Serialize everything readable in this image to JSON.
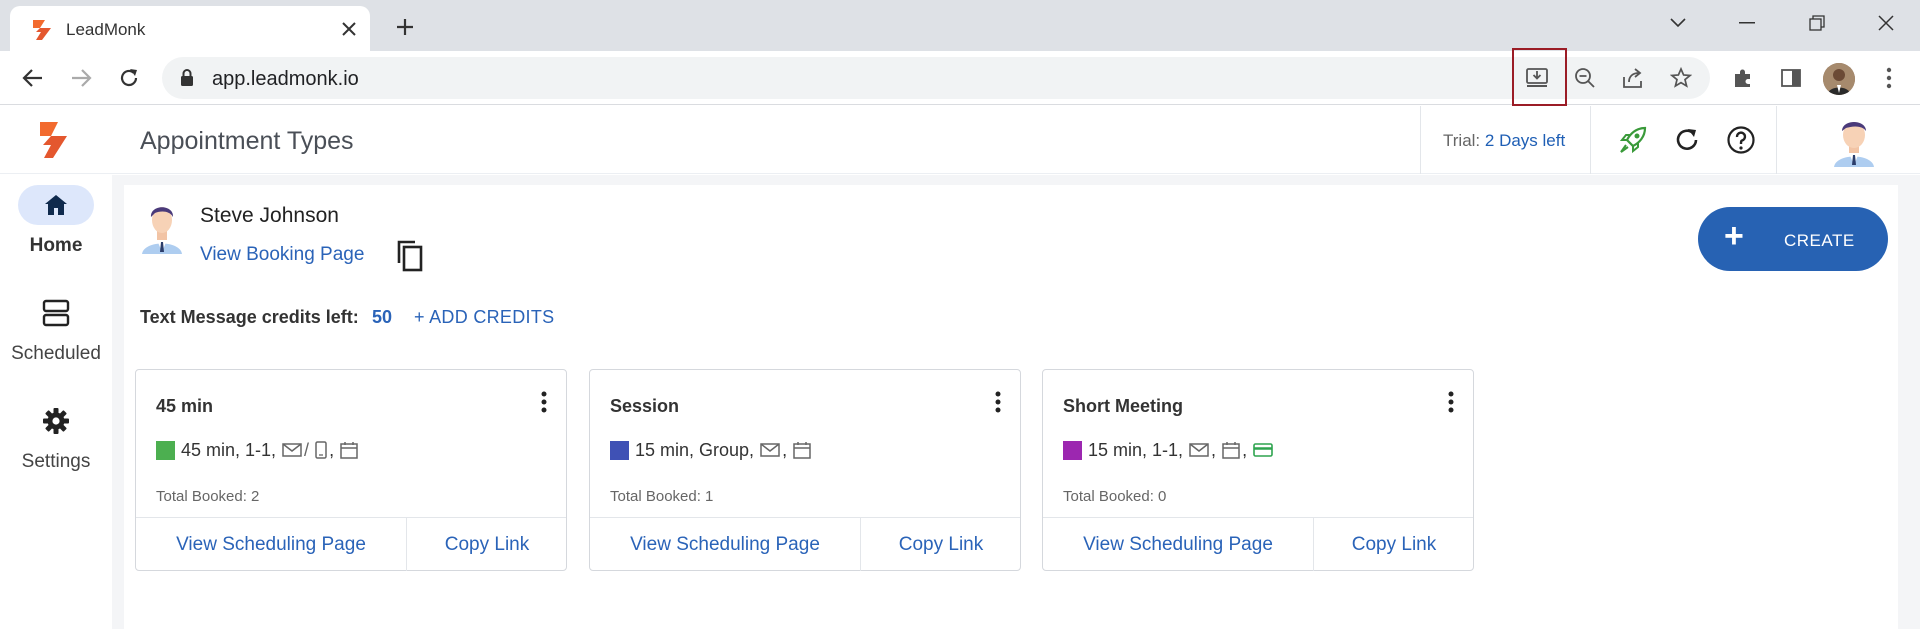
{
  "browser": {
    "tab_title": "LeadMonk",
    "url": "app.leadmonk.io"
  },
  "header": {
    "title": "Appointment Types",
    "trial_label": "Trial:",
    "trial_days": "2 Days left"
  },
  "sidebar": {
    "items": [
      {
        "label": "Home",
        "icon": "home-icon",
        "active": true
      },
      {
        "label": "Scheduled",
        "icon": "scheduled-icon",
        "active": false
      },
      {
        "label": "Settings",
        "icon": "gear-icon",
        "active": false
      }
    ]
  },
  "owner": {
    "name": "Steve Johnson",
    "booking_link": "View Booking Page"
  },
  "create_button": {
    "label": "CREATE"
  },
  "credits": {
    "label": "Text Message credits left:",
    "value": "50",
    "add_label": "+ ADD CREDITS"
  },
  "cards": [
    {
      "title": "45 min",
      "color": "#4caf50",
      "meta": "45 min, 1-1,",
      "total": "Total Booked: 2",
      "view_label": "View Scheduling Page",
      "copy_label": "Copy Link"
    },
    {
      "title": "Session",
      "color": "#3f51b5",
      "meta": "15 min, Group,",
      "total": "Total Booked: 1",
      "view_label": "View Scheduling Page",
      "copy_label": "Copy Link"
    },
    {
      "title": "Short Meeting",
      "color": "#9c27b0",
      "meta": "15 min, 1-1,",
      "total": "Total Booked: 0",
      "view_label": "View Scheduling Page",
      "copy_label": "Copy Link"
    }
  ],
  "colors": {
    "accent": "#2762b3",
    "link": "#2a63b8",
    "brand_orange": "#f26a2e",
    "highlight_box": "#9b1c26"
  }
}
